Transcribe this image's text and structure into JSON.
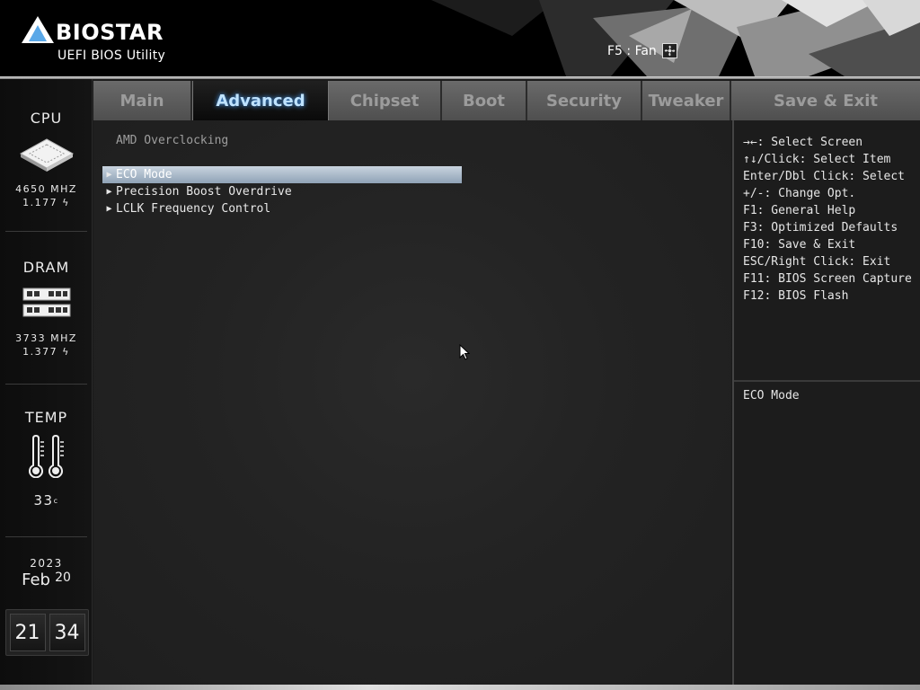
{
  "header": {
    "brand": "BIOSTAR",
    "subtitle": "UEFI BIOS Utility",
    "fan_hint": "F5 : Fan",
    "fan_icon": "fan-icon"
  },
  "sidebar": {
    "cpu": {
      "title": "CPU",
      "frequency": "4650 MHZ",
      "voltage": "1.177",
      "icon": "cpu-chip-icon"
    },
    "dram": {
      "title": "DRAM",
      "frequency": "3733 MHZ",
      "voltage": "1.377",
      "icon": "memory-module-icon"
    },
    "temp": {
      "title": "TEMP",
      "value": "33",
      "unit": "c",
      "icon": "thermometer-icon"
    },
    "date": {
      "year": "2023",
      "month": "Feb",
      "day": "20"
    },
    "clock": {
      "hours": "21",
      "minutes": "34"
    }
  },
  "tabs": [
    {
      "label": "Main",
      "active": false
    },
    {
      "label": "Advanced",
      "active": true
    },
    {
      "label": "Chipset",
      "active": false
    },
    {
      "label": "Boot",
      "active": false
    },
    {
      "label": "Security",
      "active": false
    },
    {
      "label": "Tweaker",
      "active": false
    },
    {
      "label": "Save & Exit",
      "active": false
    }
  ],
  "main": {
    "section_title": "AMD Overclocking",
    "items": [
      {
        "label": "ECO Mode",
        "selected": true
      },
      {
        "label": "Precision Boost Overdrive",
        "selected": false
      },
      {
        "label": "LCLK Frequency Control",
        "selected": false
      }
    ]
  },
  "help": {
    "keys": [
      "→←: Select Screen",
      "↑↓/Click: Select Item",
      "Enter/Dbl Click: Select",
      "+/-: Change Opt.",
      "F1: General Help",
      "F3: Optimized Defaults",
      "F10: Save & Exit",
      "ESC/Right Click: Exit",
      "F11: BIOS Screen Capture",
      "F12: BIOS Flash"
    ],
    "description": "ECO Mode"
  },
  "colors": {
    "accent_glow": "#4aa3ff",
    "selected_bar": "#a9b8c8",
    "tab_inactive": "#5c5c5c"
  }
}
